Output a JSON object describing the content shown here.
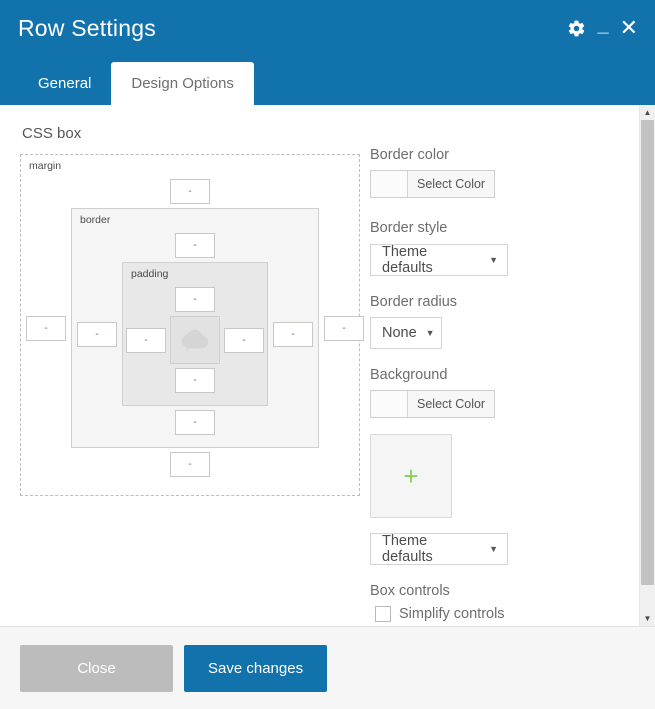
{
  "window": {
    "title": "Row Settings",
    "controls": [
      {
        "name": "settings-gear",
        "icon": "gear-icon",
        "label": ""
      },
      {
        "name": "minimize",
        "icon": "minimize-icon",
        "label": "_"
      },
      {
        "name": "close",
        "icon": "close-icon",
        "label": "✕"
      }
    ]
  },
  "tabs": [
    {
      "label": "General",
      "active": false
    },
    {
      "label": "Design Options",
      "active": true
    }
  ],
  "css_box": {
    "section_title": "CSS box",
    "labels": {
      "margin": "margin",
      "border": "border",
      "padding": "padding"
    },
    "placeholder": "-",
    "inputs": {
      "margin_top": "",
      "margin_right": "",
      "margin_bottom": "",
      "margin_left": "",
      "border_top": "",
      "border_right": "",
      "border_bottom": "",
      "border_left": "",
      "padding_top": "",
      "padding_right": "",
      "padding_bottom": "",
      "padding_left": ""
    },
    "content_icon": "image-placeholder-icon"
  },
  "controls": {
    "border_color": {
      "label": "Border color",
      "button_label": "Select Color",
      "swatch_color": "#fbfbfb"
    },
    "border_style": {
      "label": "Border style",
      "value": "Theme defaults"
    },
    "border_radius": {
      "label": "Border radius",
      "value": "None"
    },
    "background": {
      "label": "Background",
      "button_label": "Select Color",
      "swatch_color": "#fbfbfb",
      "upload_icon": "plus-icon",
      "upload_glyph": "+",
      "style_value": "Theme defaults"
    },
    "box_controls": {
      "label": "Box controls",
      "checkbox_label": "Simplify controls",
      "checked": false
    }
  },
  "footer": {
    "close_label": "Close",
    "save_label": "Save changes"
  },
  "scrollbar": {
    "up_glyph": "▲",
    "down_glyph": "▼"
  },
  "theme": {
    "accent_blue": "#1272ac",
    "gray_button": "#bcbcbc",
    "plus_green": "#8bd05a"
  }
}
